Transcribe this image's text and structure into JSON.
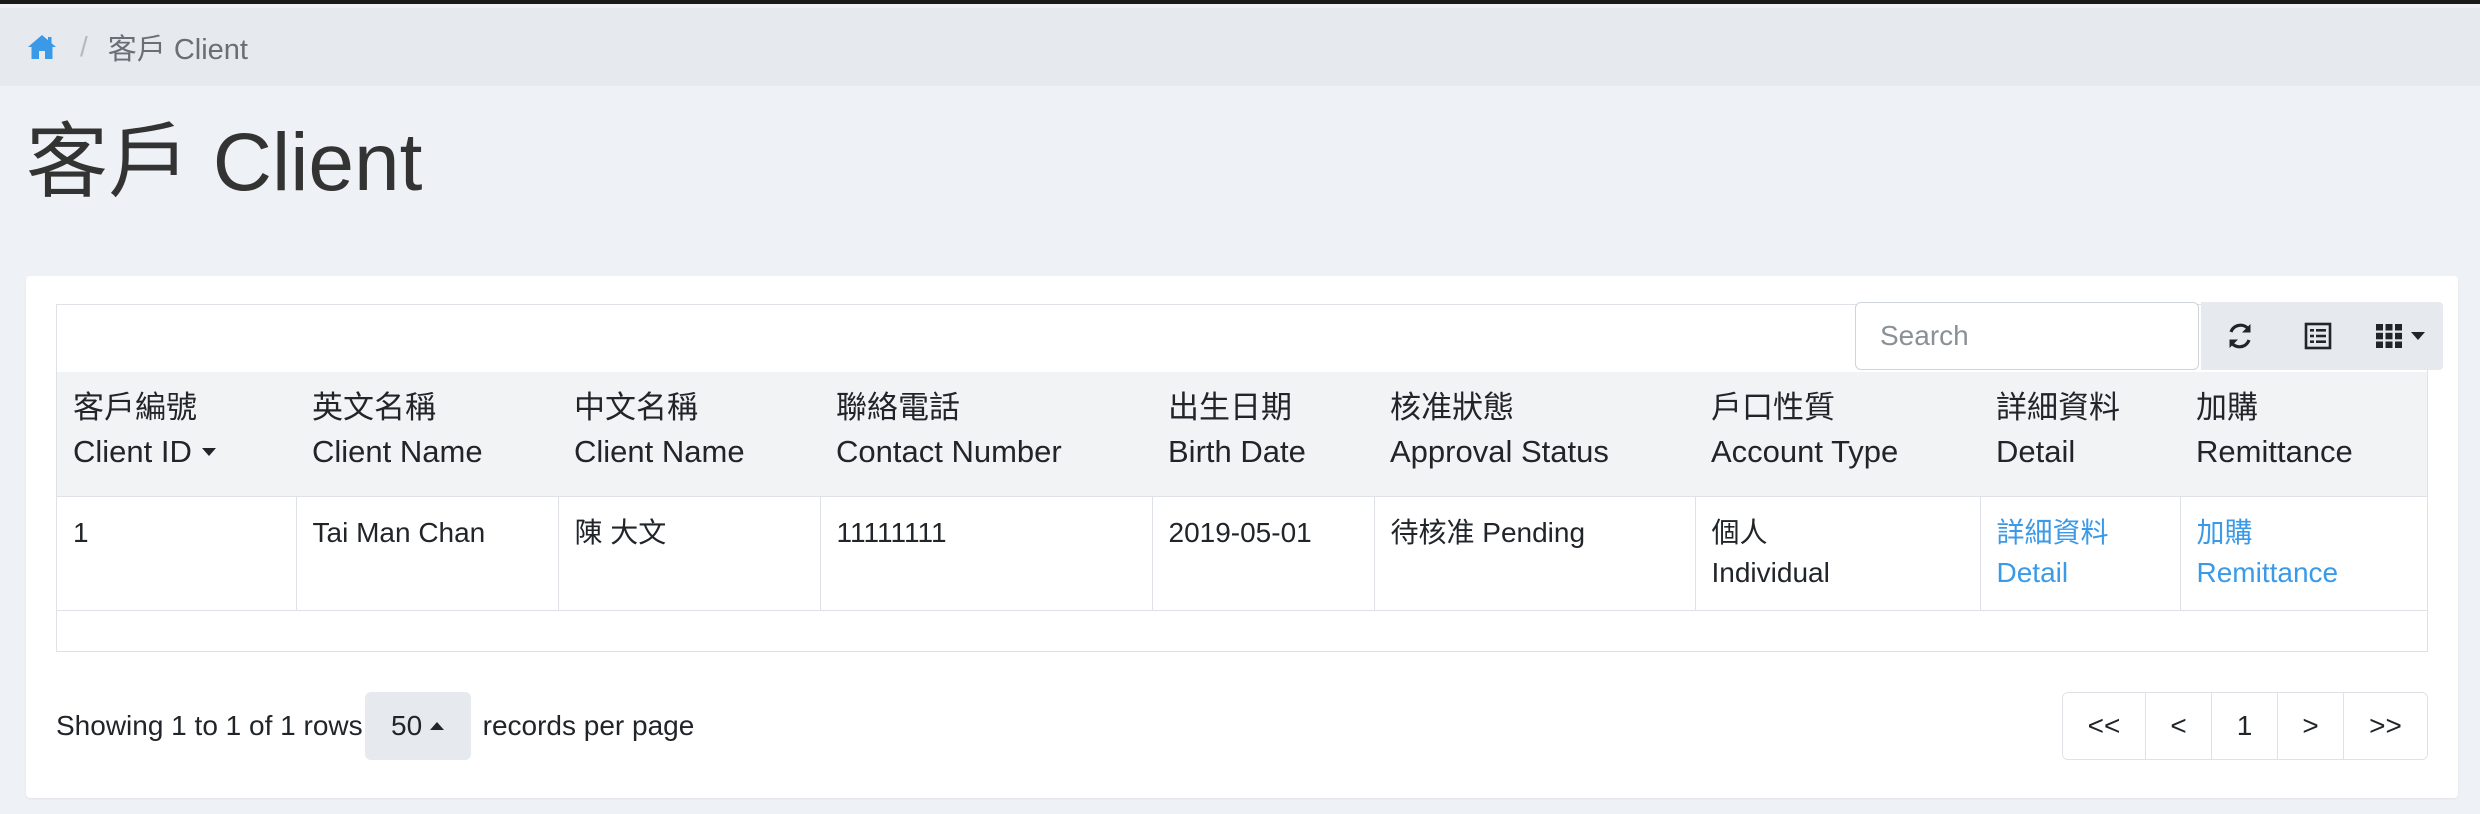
{
  "breadcrumb": {
    "home_icon": "home-icon",
    "separator": "/",
    "current": "客戶 Client"
  },
  "page": {
    "title": "客戶 Client"
  },
  "toolbar": {
    "search_placeholder": "Search",
    "refresh_icon": "refresh-icon",
    "toggle_icon": "list-icon",
    "columns_icon": "columns-grid-icon"
  },
  "table": {
    "headers": [
      {
        "zh": "客戶編號",
        "en": "Client ID",
        "sorted": "desc"
      },
      {
        "zh": "英文名稱",
        "en": "Client Name"
      },
      {
        "zh": "中文名稱",
        "en": "Client Name"
      },
      {
        "zh": "聯絡電話",
        "en": "Contact Number"
      },
      {
        "zh": "出生日期",
        "en": "Birth Date"
      },
      {
        "zh": "核准狀態",
        "en": "Approval Status"
      },
      {
        "zh": "戶口性質",
        "en": "Account Type"
      },
      {
        "zh": "詳細資料",
        "en": "Detail"
      },
      {
        "zh": "加購",
        "en": "Remittance"
      }
    ],
    "rows": [
      {
        "client_id": "1",
        "english_name": "Tai Man Chan",
        "chinese_name": "陳 大文",
        "contact_number": "11111111",
        "birth_date": "2019-05-01",
        "approval_status": "待核准 Pending",
        "account_type_zh": "個人",
        "account_type_en": "Individual",
        "detail_zh": "詳細資料",
        "detail_en": "Detail",
        "remittance_zh": "加購",
        "remittance_en": "Remittance"
      }
    ]
  },
  "footer": {
    "showing": "Showing 1 to 1 of 1 rows",
    "page_size": "50",
    "per_page": "records per page"
  },
  "pagination": {
    "first": "<<",
    "prev": "<",
    "current": "1",
    "next": ">",
    "last": ">>"
  },
  "colors": {
    "link": "#3b9ae8",
    "home_icon": "#3b9ae8"
  }
}
